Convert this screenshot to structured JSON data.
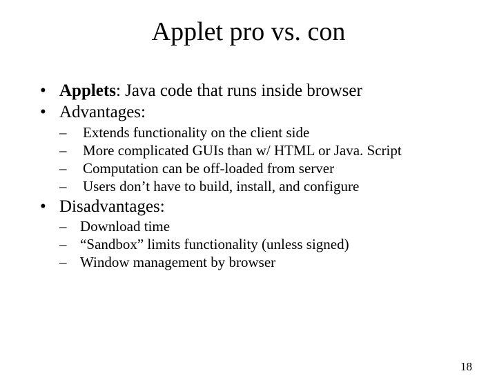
{
  "title": "Applet pro vs. con",
  "bullets": {
    "b1_label": "Applets",
    "b1_text": ": Java code that runs inside browser",
    "b2": "Advantages:",
    "b2_sub": [
      "Extends functionality on the client side",
      "More complicated GUIs than w/ HTML or Java. Script",
      "Computation can be off-loaded from server",
      "Users don’t have to build, install, and configure"
    ],
    "b3": "Disadvantages:",
    "b3_sub": [
      "Download time",
      "“Sandbox” limits functionality (unless signed)",
      "Window management by browser"
    ]
  },
  "page_number": "18",
  "glyphs": {
    "bullet": "•",
    "dash": "–"
  }
}
